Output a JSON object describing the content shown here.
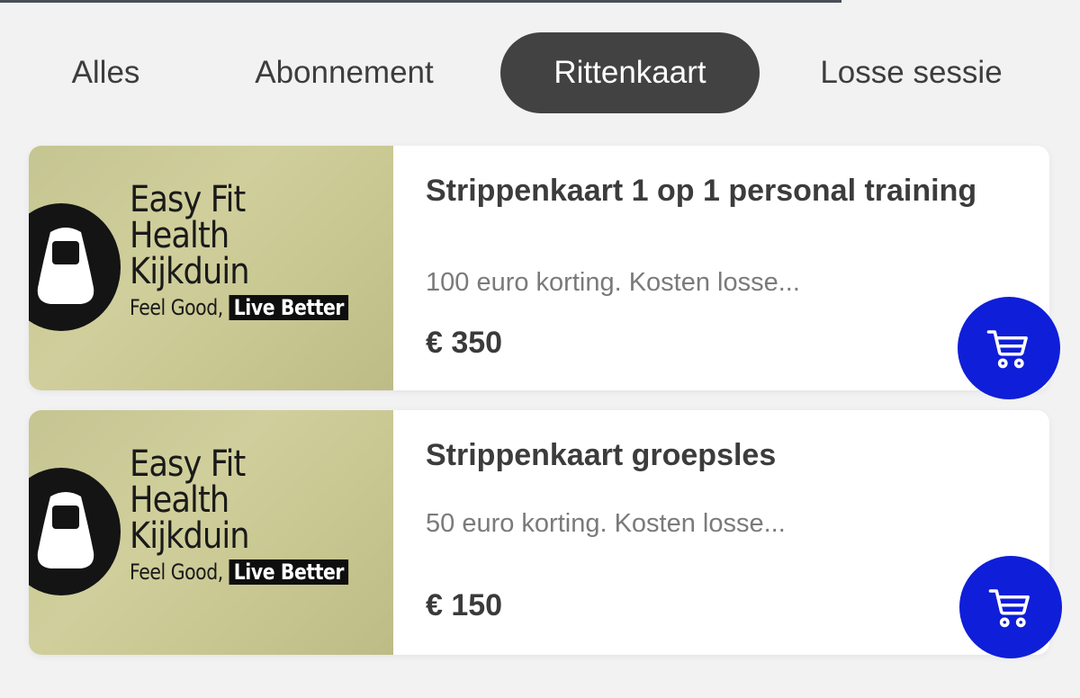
{
  "tabs": [
    {
      "label": "Alles",
      "active": false
    },
    {
      "label": "Abonnement",
      "active": false
    },
    {
      "label": "Rittenkaart",
      "active": true
    },
    {
      "label": "Losse sessie",
      "active": false
    }
  ],
  "brand": {
    "line1": "Easy Fit",
    "line2": "Health",
    "line3": "Kijkduin",
    "tagline_plain": "Feel Good,",
    "tagline_highlight": "Live Better"
  },
  "products": [
    {
      "title": "Strippenkaart 1 op 1 personal training",
      "description": "100 euro korting. Kosten losse...",
      "price": "€ 350",
      "icon": "cart-icon"
    },
    {
      "title": "Strippenkaart groepsles",
      "description": "50 euro korting. Kosten losse...",
      "price": "€ 150",
      "icon": "cart-icon"
    }
  ],
  "colors": {
    "background": "#f2f2f3",
    "active_tab": "#424242",
    "cart_button": "#0f1ed8",
    "thumbnail": "#c9c895"
  }
}
